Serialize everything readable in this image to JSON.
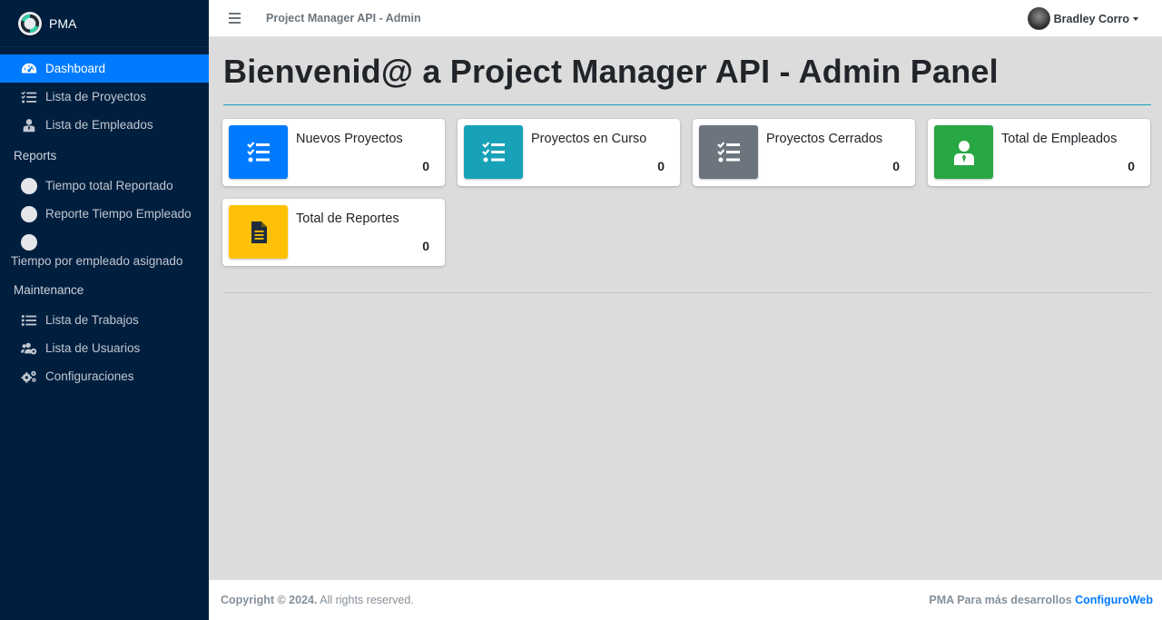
{
  "brand": {
    "name": "PMA"
  },
  "sidebar": {
    "items": [
      {
        "label": "Dashboard",
        "icon": "tachometer-icon"
      },
      {
        "label": "Lista de Proyectos",
        "icon": "tasks-icon"
      },
      {
        "label": "Lista de Empleados",
        "icon": "user-tie-icon"
      }
    ],
    "reports_header": "Reports",
    "reports": [
      {
        "label": "Tiempo total Reportado",
        "icon": "circle-icon"
      },
      {
        "label": "Reporte Tiempo Empleado",
        "icon": "circle-icon"
      },
      {
        "label": "Tiempo por empleado asignado",
        "icon": "circle-icon"
      }
    ],
    "maintenance_header": "Maintenance",
    "maintenance": [
      {
        "label": "Lista de Trabajos",
        "icon": "list-icon"
      },
      {
        "label": "Lista de Usuarios",
        "icon": "users-cog-icon"
      },
      {
        "label": "Configuraciones",
        "icon": "cogs-icon"
      }
    ]
  },
  "topbar": {
    "title": "Project Manager API - Admin",
    "user": "Bradley Corro"
  },
  "main": {
    "title": "Bienvenid@ a Project Manager API - Admin Panel",
    "cards": [
      {
        "label": "Nuevos Proyectos",
        "value": "0",
        "color": "#007bff",
        "icon": "tasks-icon"
      },
      {
        "label": "Proyectos en Curso",
        "value": "0",
        "color": "#17a2b8",
        "icon": "tasks-icon"
      },
      {
        "label": "Proyectos Cerrados",
        "value": "0",
        "color": "#6c757d",
        "icon": "tasks-icon"
      },
      {
        "label": "Total de Empleados",
        "value": "0",
        "color": "#28a745",
        "icon": "user-tie-icon"
      },
      {
        "label": "Total de Reportes",
        "value": "0",
        "color": "#ffc107",
        "icon": "file-alt-icon"
      }
    ]
  },
  "footer": {
    "copyright_bold": "Copyright © 2024.",
    "copyright_rest": " All rights reserved.",
    "right_text": "PMA Para más desarrollos ",
    "right_link": "ConfiguroWeb"
  },
  "colors": {
    "sidebar": "#001f3f",
    "active": "#007bff",
    "accent_rule": "#17a2b8"
  }
}
